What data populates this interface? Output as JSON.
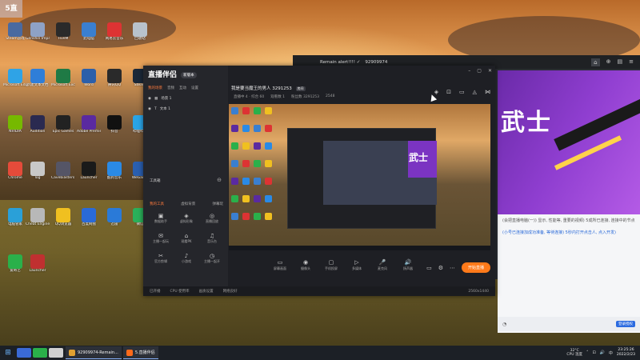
{
  "desktop": {
    "corner_overlay": "5直",
    "icons": [
      {
        "label": "Steam游戏",
        "color": "#4a6aa0"
      },
      {
        "label": "Genshin Impact",
        "color": "#8ea2c6"
      },
      {
        "label": "FiveM",
        "color": "#2a2a2a"
      },
      {
        "label": "此电脑",
        "color": "#3a7fd0"
      },
      {
        "label": "网易云音乐",
        "color": "#d33"
      },
      {
        "label": "回收站",
        "color": "#b8c2cc"
      },
      {
        "label": "Microsoft Edge",
        "color": "#2fa3e6"
      },
      {
        "label": "新建文本文档",
        "color": "#2f7ed8"
      },
      {
        "label": "Microsoft Excel",
        "color": "#1f7a45"
      },
      {
        "label": "Word",
        "color": "#2b5faa"
      },
      {
        "label": "腾讯QQ",
        "color": "#2a2a2a"
      },
      {
        "label": "Steam",
        "color": "#1b2838"
      },
      {
        "label": "NVIDIA",
        "color": "#76b900"
      },
      {
        "label": "Audition",
        "color": "#2a2a50"
      },
      {
        "label": "Epic Games",
        "color": "#222"
      },
      {
        "label": "Adobe Premiere",
        "color": "#5a2aa0"
      },
      {
        "label": "抖音",
        "color": "#111"
      },
      {
        "label": "哔哩哔哩",
        "color": "#2aa4e6"
      },
      {
        "label": "Chrome",
        "color": "#e54b3a"
      },
      {
        "label": "log",
        "color": "#c8c8c8"
      },
      {
        "label": "Cavebiasters Together",
        "color": "#556"
      },
      {
        "label": "Launcher",
        "color": "#1a1a1a"
      },
      {
        "label": "酷狗音乐",
        "color": "#2a8ae6"
      },
      {
        "label": "WeGame",
        "color": "#2a5fb0"
      },
      {
        "label": "电脑管家",
        "color": "#2aa0d8"
      },
      {
        "label": "Cheat Engine",
        "color": "#b8b8b8"
      },
      {
        "label": "QQ浏览器",
        "color": "#f0c020"
      },
      {
        "label": "百度网盘",
        "color": "#2a6ad8"
      },
      {
        "label": "迅雷",
        "color": "#2a7ad8"
      },
      {
        "label": "微信",
        "color": "#2ab05a"
      },
      {
        "label": "爱奇艺",
        "color": "#2ab04a"
      },
      {
        "label": "Launcher",
        "color": "#c03030"
      }
    ]
  },
  "browser": {
    "tab_title": "Remain alert!!!! ✓",
    "tab_id": "92909974",
    "banner_text": "武士",
    "doc_line_1": "(会把直播电脑(一)) 显示, 性能等, 重要的视频) 5成所已连接, 连接中的节点",
    "doc_line_2": "(小号已连接加成功准备, 等待连接) 5秒内打开点击人, 点入开发)",
    "doc_button": "登录授权"
  },
  "app": {
    "logo": "直播伴侣",
    "logo_badge": "新版本",
    "tabs": [
      "我的场景",
      "音频",
      "互动",
      "设置"
    ],
    "scenes": [
      "场景 1",
      "文本 1"
    ],
    "tool_header": "工具箱",
    "tool_tabs": [
      "我的工具",
      "虚拟背景",
      "弹幕玩"
    ],
    "tools": [
      {
        "icon": "▣",
        "label": "数据助手"
      },
      {
        "icon": "◈",
        "label": "虚拟形象"
      },
      {
        "icon": "◎",
        "label": "直播回放"
      },
      {
        "icon": "✉",
        "label": "主播一起玩"
      },
      {
        "icon": "⌂",
        "label": "观看PK"
      },
      {
        "icon": "♫",
        "label": "音乐台"
      },
      {
        "icon": "✂",
        "label": "官方剪辑"
      },
      {
        "icon": "♪",
        "label": "小游戏"
      },
      {
        "icon": "◷",
        "label": "主播一起开"
      }
    ],
    "title": "我是要当魔王的男人",
    "room_id": "3291253",
    "title_tag": "房间",
    "stats": [
      "直播中 4 · 综合 60",
      "观看数 1",
      "粉丝数 3291253",
      "2548"
    ],
    "bottom_tools": [
      {
        "icon": "▭",
        "label": "屏幕画面"
      },
      {
        "icon": "◉",
        "label": "摄像头"
      },
      {
        "icon": "▢",
        "label": "手机投屏"
      },
      {
        "icon": "▷",
        "label": "多媒体"
      },
      {
        "icon": "🎤",
        "label": "麦克风"
      },
      {
        "icon": "🔊",
        "label": "扬声器"
      }
    ],
    "go_live": "开始直播",
    "status_items": [
      "已开播",
      "CPU 使用率",
      "画质设置",
      "网络良好"
    ],
    "perf": "2560x1440"
  },
  "taskbar": {
    "apps": [
      {
        "label": "92909974-Remain...",
        "color": "#e0a030"
      },
      {
        "label": "5.直播伴侣",
        "color": "#ff6a1a"
      }
    ],
    "weather": "32°C",
    "weather_sub": "CPU 温度",
    "tray_lang": "中",
    "clock_time": "23:25:26",
    "clock_date": "2022/2/23"
  }
}
